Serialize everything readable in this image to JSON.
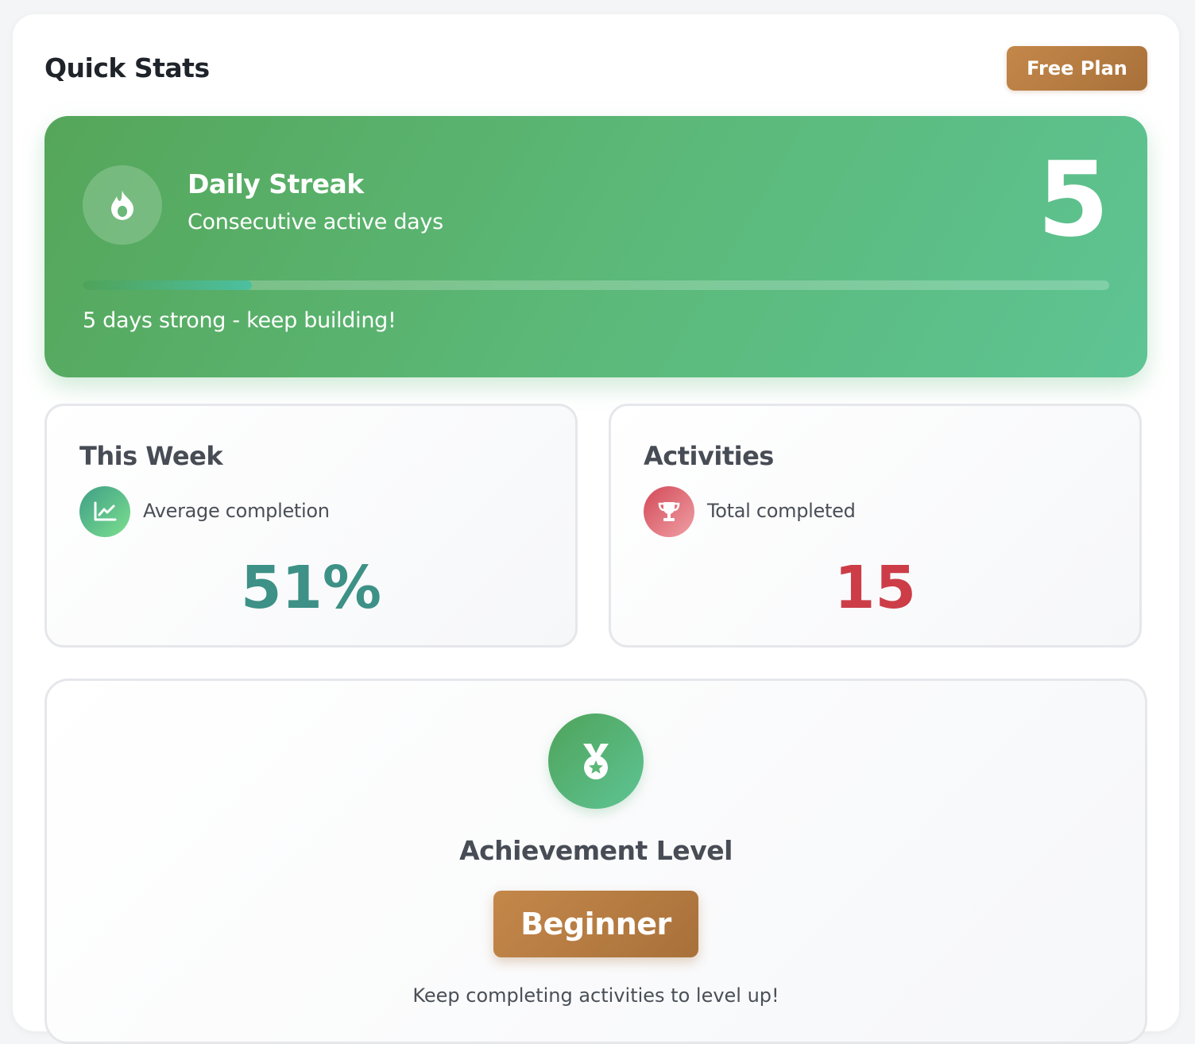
{
  "header": {
    "title": "Quick Stats",
    "plan_label": "Free Plan"
  },
  "streak": {
    "title": "Daily Streak",
    "subtitle": "Consecutive active days",
    "count": "5",
    "message": "5 days strong - keep building!",
    "progress_percent": 16.5,
    "icon": "fire-icon"
  },
  "stats": {
    "week": {
      "title": "This Week",
      "label": "Average completion",
      "value": "51%",
      "icon": "chart-line-icon",
      "color": "#3d9186"
    },
    "activities": {
      "title": "Activities",
      "label": "Total completed",
      "value": "15",
      "icon": "trophy-icon",
      "color": "#cc3d48"
    }
  },
  "achievement": {
    "title": "Achievement Level",
    "level": "Beginner",
    "hint": "Keep completing activities to level up!",
    "icon": "medal-icon"
  },
  "colors": {
    "streak_green": "#5bb877",
    "badge_brown": "#b87c42",
    "teal": "#3d9186",
    "red": "#cc3d48"
  }
}
